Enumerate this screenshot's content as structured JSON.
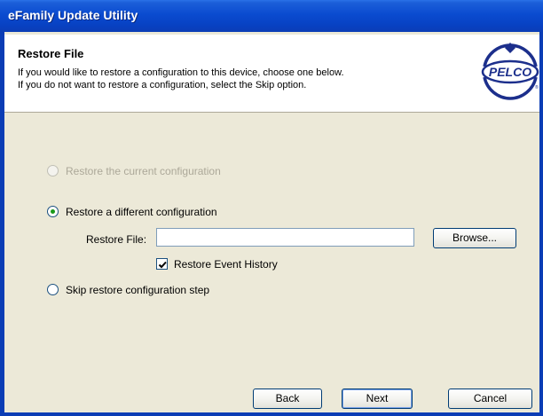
{
  "window": {
    "title": "eFamily Update Utility"
  },
  "header": {
    "title": "Restore File",
    "line1": "If you would like to restore a configuration to this device, choose one below.",
    "line2": "If you do not want to restore a configuration, select the Skip option.",
    "logo_text": "PELCO"
  },
  "options": {
    "restore_current": {
      "label": "Restore the current configuration",
      "enabled": false,
      "selected": false
    },
    "restore_different": {
      "label": "Restore a different configuration",
      "enabled": true,
      "selected": true
    },
    "skip": {
      "label": "Skip restore configuration step",
      "enabled": true,
      "selected": false
    }
  },
  "restore_file": {
    "label": "Restore File:",
    "value": ""
  },
  "browse_button": "Browse...",
  "event_history": {
    "label": "Restore Event History",
    "checked": true
  },
  "footer": {
    "back": "Back",
    "next": "Next",
    "cancel": "Cancel"
  },
  "colors": {
    "titlebar": "#0a4bd0",
    "face": "#ece9d8",
    "radio_dot": "#1a9a1a"
  }
}
